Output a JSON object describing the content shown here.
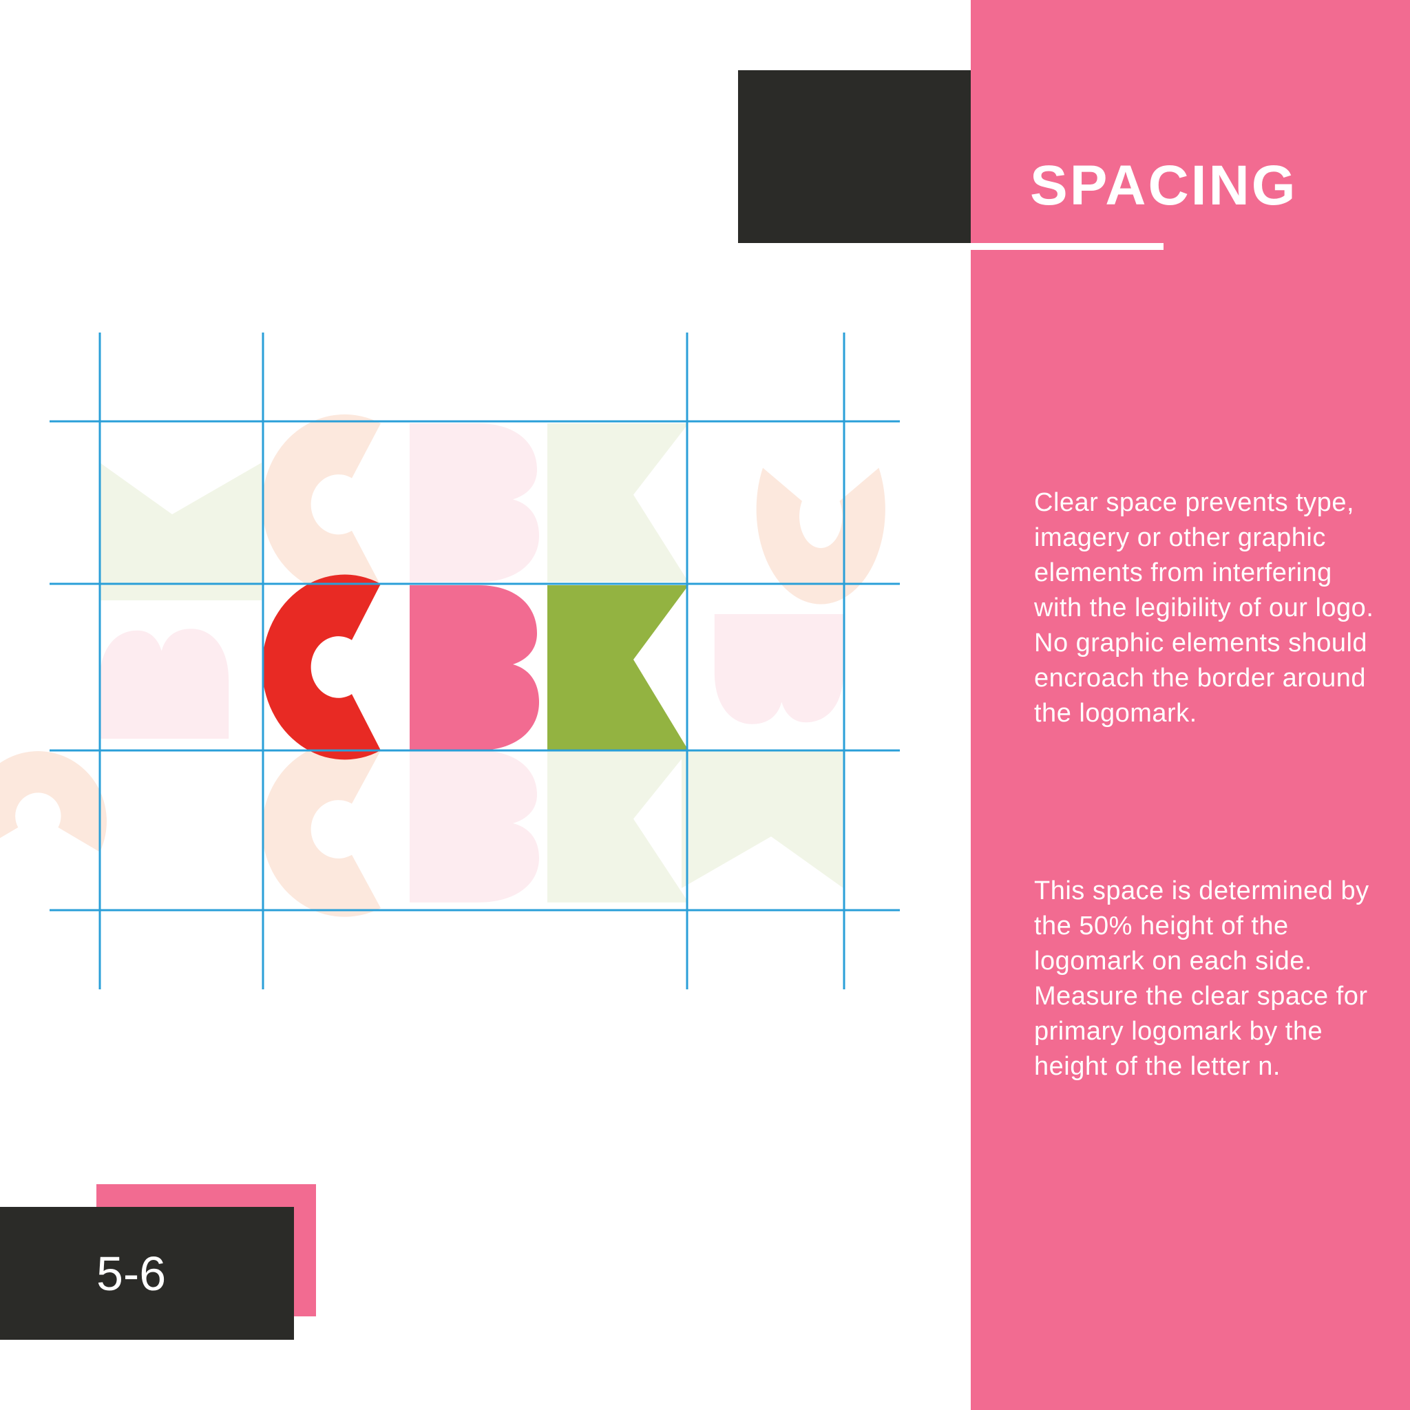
{
  "page": {
    "title": "SPACING",
    "number": "5-6"
  },
  "logo": {
    "letters": [
      "C",
      "B",
      "K"
    ],
    "colors": {
      "c": "#e82a24",
      "b": "#f26b91",
      "k": "#93b341",
      "c_faded": "#fce8dd",
      "b_faded": "#fdecf0",
      "k_faded": "#f1f5e7",
      "grid": "#2a9fd8"
    }
  },
  "body": {
    "paragraphs": [
      "Clear space prevents type, imagery or other graphic elements from interfering with the legibility of our logo. No graphic elements should encroach the border around the logomark.",
      "This space is determined by the 50% height of the logomark on each side. Measure the clear space for primary logomark by the height of the letter n."
    ]
  },
  "colors": {
    "panel_pink": "#f26b91",
    "dark": "#2b2b28",
    "text_on_pink": "#ffffff"
  }
}
